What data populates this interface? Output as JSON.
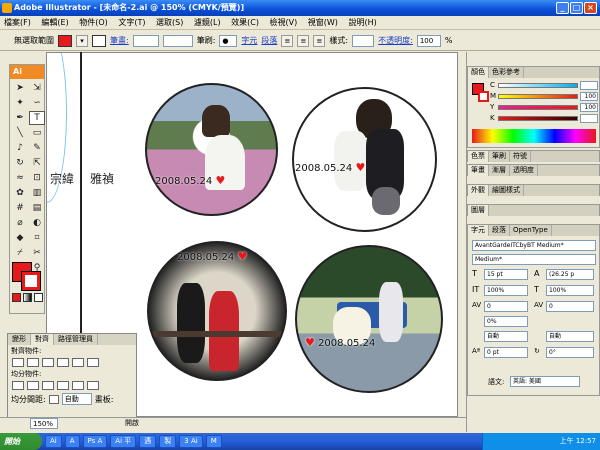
{
  "window": {
    "title": "Adobe Illustrator - [未命名-2.ai @ 150% (CMYK/預覽)]",
    "controls": [
      "_",
      "□",
      "×"
    ]
  },
  "menu": [
    "檔案(F)",
    "編輯(E)",
    "物件(O)",
    "文字(T)",
    "選取(S)",
    "濾鏡(L)",
    "效果(C)",
    "檢視(V)",
    "視窗(W)",
    "說明(H)"
  ],
  "control_bar": {
    "selection": "無選取範圍",
    "stroke_link": "筆畫:",
    "brush_label": "筆刷:",
    "char_link": "字元",
    "para_link": "段落",
    "style_label": "樣式:",
    "opacity_link": "不透明度:",
    "opacity_value": "100",
    "percent": "%"
  },
  "toolbox": {
    "header": "Ai"
  },
  "canvas": {
    "left_text_1": "宗緯",
    "left_text_2": "雅禎",
    "photos": [
      {
        "date": "2008.05.24",
        "scene": "flower field"
      },
      {
        "date": "2008.05.24",
        "scene": "snow dog"
      },
      {
        "date": "2008.05.24",
        "scene": "red dress"
      },
      {
        "date": "2008.05.24",
        "scene": "bench"
      }
    ]
  },
  "align_panel": {
    "tabs": [
      "變形",
      "對齊",
      "路徑管理員"
    ],
    "distribute_label": "對齊物件:",
    "even_label": "均分物件:",
    "spacing_label": "均分間距:",
    "auto": "自動",
    "aspect_label": "畫板:"
  },
  "color_panel": {
    "tabs": [
      "顏色",
      "色彩參考"
    ],
    "channels": [
      {
        "label": "C",
        "value": ""
      },
      {
        "label": "M",
        "value": "100"
      },
      {
        "label": "Y",
        "value": "100"
      },
      {
        "label": "K",
        "value": ""
      }
    ],
    "percent": "%"
  },
  "panels": {
    "swatches_tabs": [
      "色票",
      "筆刷",
      "符號"
    ],
    "stroke_tabs": [
      "筆畫",
      "漸層",
      "透明度"
    ],
    "appearance_tabs": [
      "外觀",
      "繪圖樣式"
    ],
    "layers_tabs": [
      "圖層"
    ]
  },
  "char_panel": {
    "tabs": [
      "字元",
      "段落",
      "OpenType"
    ],
    "font_family": "AvantGardeITCbyBT Medium*",
    "font_style": "Medium*",
    "size": "15 pt",
    "leading": "(26.25 p",
    "h_scale": "100%",
    "v_scale": "100%",
    "kerning": "0",
    "tracking": "0",
    "tsume": "0%",
    "auto1": "自動",
    "auto2": "自動",
    "baseline": "0 pt",
    "rotate": "0°",
    "lang_label": "語文:",
    "lang": "英語: 美國"
  },
  "status": {
    "zoom": "150%",
    "mode": "開啟"
  },
  "taskbar": {
    "start": "開始",
    "tasks": [
      "Ai",
      "A",
      "Ps A",
      "Ai 平",
      "遇",
      "製",
      "3 Ai",
      "M"
    ],
    "clock": "上午 12:57"
  },
  "colors": {
    "fill": "#e8191a",
    "accent": "#f08a24",
    "link": "#1a3ec8"
  }
}
